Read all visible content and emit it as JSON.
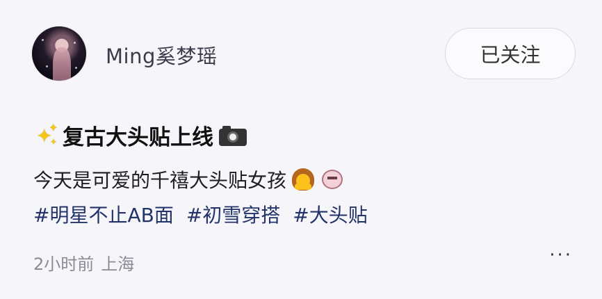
{
  "user": {
    "name": "Ming奚梦瑶",
    "follow_label": "已关注"
  },
  "post": {
    "title_text": "复古大头贴上线",
    "content_text": "今天是可爱的千禧大头贴女孩",
    "hashtags": [
      "#明星不止AB面",
      "#初雪穿搭",
      "#大头贴"
    ],
    "time": "2小时前",
    "location": "上海",
    "more_label": "···"
  },
  "icons": {
    "title_leading": "sparkles-icon",
    "title_trailing": "camera-icon",
    "content_emoji_1": "person-gesturing-ok-icon",
    "content_emoji_2": "face-icon"
  },
  "colors": {
    "background": "#f6f6fa",
    "hashtag": "#22336a",
    "meta": "#8a8a94",
    "follow_border": "#d8d8e0"
  }
}
